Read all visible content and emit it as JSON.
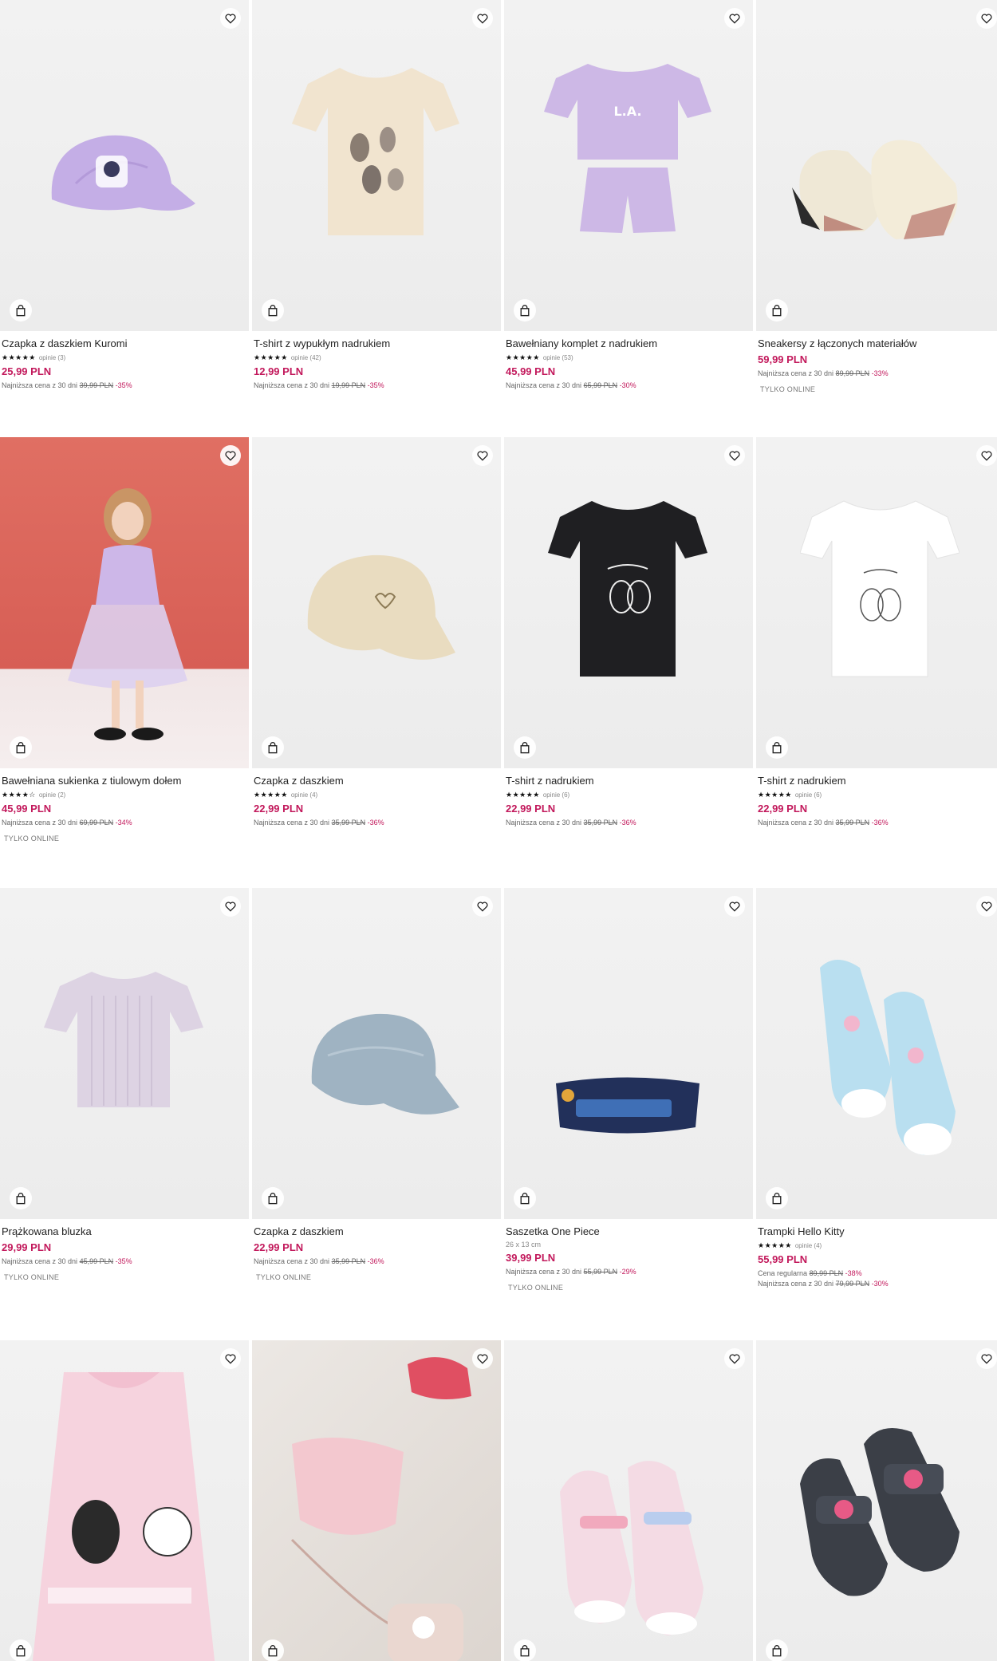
{
  "colors": {
    "price": "#c2185b",
    "text": "#222222",
    "muted": "#666666"
  },
  "icons": {
    "favorite": "heart-icon",
    "cart": "shopping-bag-icon",
    "star": "star-icon"
  },
  "products": [
    {
      "name": "Czapka z daszkiem Kuromi",
      "stars": "★★★★★",
      "rating_text": "opinie (3)",
      "price": "25,99 PLN",
      "lowest_label": "Najniższa cena z 30 dni",
      "old_price": "39,99 PLN",
      "discount": "-35%"
    },
    {
      "name": "T-shirt z wypukłym nadrukiem",
      "stars": "★★★★★",
      "rating_text": "opinie (42)",
      "price": "12,99 PLN",
      "lowest_label": "Najniższa cena z 30 dni",
      "old_price": "19,99 PLN",
      "discount": "-35%"
    },
    {
      "name": "Bawełniany komplet z nadrukiem",
      "stars": "★★★★★",
      "rating_text": "opinie (53)",
      "price": "45,99 PLN",
      "lowest_label": "Najniższa cena z 30 dni",
      "old_price": "65,99 PLN",
      "discount": "-30%"
    },
    {
      "name": "Sneakersy z łączonych materiałów",
      "price": "59,99 PLN",
      "lowest_label": "Najniższa cena z 30 dni",
      "old_price": "89,99 PLN",
      "discount": "-33%",
      "badge": "TYLKO ONLINE"
    },
    {
      "name": "Bawełniana sukienka z tiulowym dołem",
      "stars": "★★★★☆",
      "rating_text": "opinie (2)",
      "price": "45,99 PLN",
      "lowest_label": "Najniższa cena z 30 dni",
      "old_price": "69,99 PLN",
      "discount": "-34%",
      "badge": "TYLKO ONLINE"
    },
    {
      "name": "Czapka z daszkiem",
      "stars": "★★★★★",
      "rating_text": "opinie (4)",
      "price": "22,99 PLN",
      "lowest_label": "Najniższa cena z 30 dni",
      "old_price": "35,99 PLN",
      "discount": "-36%"
    },
    {
      "name": "T-shirt z nadrukiem",
      "stars": "★★★★★",
      "rating_text": "opinie (6)",
      "price": "22,99 PLN",
      "lowest_label": "Najniższa cena z 30 dni",
      "old_price": "35,99 PLN",
      "discount": "-36%"
    },
    {
      "name": "T-shirt z nadrukiem",
      "stars": "★★★★★",
      "rating_text": "opinie (6)",
      "price": "22,99 PLN",
      "lowest_label": "Najniższa cena z 30 dni",
      "old_price": "35,99 PLN",
      "discount": "-36%"
    },
    {
      "name": "Prążkowana bluzka",
      "price": "29,99 PLN",
      "lowest_label": "Najniższa cena z 30 dni",
      "old_price": "45,99 PLN",
      "discount": "-35%",
      "badge": "TYLKO ONLINE"
    },
    {
      "name": "Czapka z daszkiem",
      "price": "22,99 PLN",
      "lowest_label": "Najniższa cena z 30 dni",
      "old_price": "35,99 PLN",
      "discount": "-36%",
      "badge": "TYLKO ONLINE"
    },
    {
      "name": "Saszetka One Piece",
      "size": "26 x 13 cm",
      "price": "39,99 PLN",
      "lowest_label": "Najniższa cena z 30 dni",
      "old_price": "55,99 PLN",
      "discount": "-29%",
      "badge": "TYLKO ONLINE"
    },
    {
      "name": "Trampki Hello Kitty",
      "stars": "★★★★★",
      "rating_text": "opinie (4)",
      "price": "55,99 PLN",
      "regular_label": "Cena regularna",
      "regular_old": "89,99 PLN",
      "regular_discount": "-38%",
      "lowest_label": "Najniższa cena z 30 dni",
      "old_price": "79,99 PLN",
      "discount": "-30%"
    },
    {},
    {},
    {},
    {}
  ]
}
